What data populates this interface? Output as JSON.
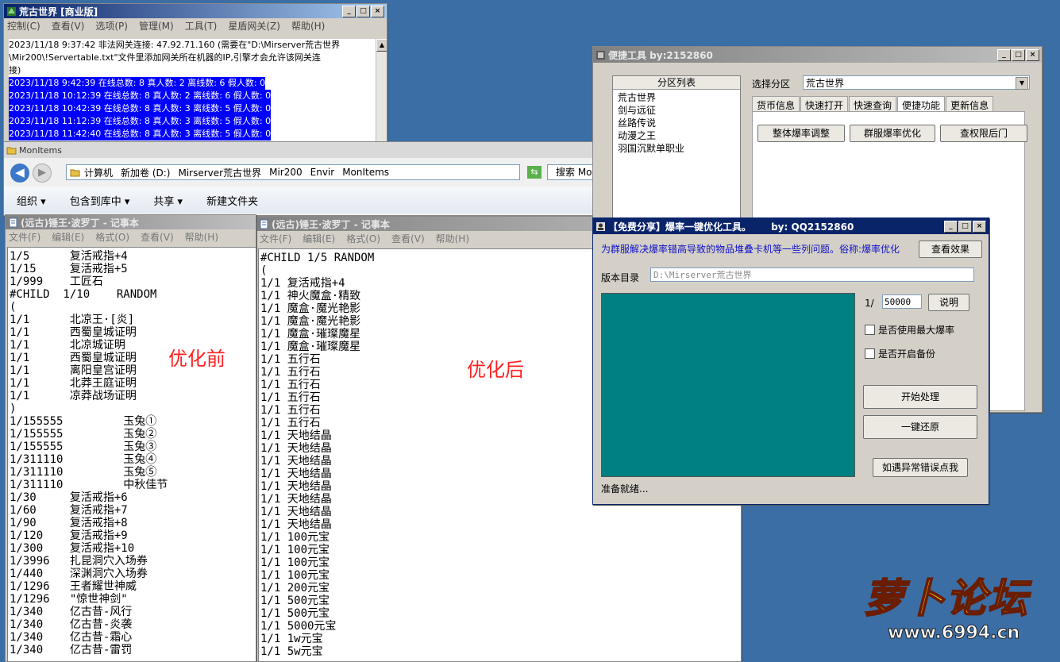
{
  "log_window": {
    "title": "荒古世界 [商业版]",
    "menu": [
      "控制(C)",
      "查看(V)",
      "选项(P)",
      "管理(M)",
      "工具(T)",
      "星盾网关(Z)",
      "帮助(H)"
    ],
    "lines": [
      "2023/11/18 9:37:42 非法网关连接: 47.92.71.160 (需要在\"D:\\Mirserver荒古世界",
      "\\Mir200\\!Servertable.txt\"文件里添加网关所在机器的IP,引擎才会允许该网关连",
      "接)"
    ],
    "highlighted": [
      "2023/11/18 9:42:39 在线总数: 8 真人数: 2 离线数: 6 假人数: 0",
      "2023/11/18 10:12:39 在线总数: 8 真人数: 2 离线数: 6 假人数: 0",
      "2023/11/18 10:42:39 在线总数: 8 真人数: 3 离线数: 5 假人数: 0",
      "2023/11/18 11:12:39 在线总数: 8 真人数: 3 离线数: 5 假人数: 0",
      "2023/11/18 11:42:40 在线总数: 8 真人数: 3 离线数: 5 假人数: 0"
    ]
  },
  "explorer": {
    "title": "MonItems",
    "path": [
      "计算机",
      "新加卷 (D:)",
      "Mirserver荒古世界",
      "Mir200",
      "Envir",
      "MonItems"
    ],
    "search": "搜索 Mon",
    "toolbar": [
      "组织",
      "包含到库中",
      "共享",
      "新建文件夹"
    ]
  },
  "notepad_left": {
    "title": "(远古)锤王·波罗丁 - 记事本",
    "menu": [
      "文件(F)",
      "编辑(E)",
      "格式(O)",
      "查看(V)",
      "帮助(H)"
    ],
    "content": "1/5      复活戒指+4\n1/15     复活戒指+5\n1/999    工匠石\n#CHILD  1/10    RANDOM\n(\n1/1      北凉王·[炎]\n1/1      西蜀皇城证明\n1/1      北凉城证明\n1/1      西蜀皇城证明\n1/1      离阳皇宫证明\n1/1      北莽王庭证明\n1/1      凉莽战场证明\n)\n1/155555         玉兔①\n1/155555         玉兔②\n1/155555         玉兔③\n1/311110         玉兔④\n1/311110         玉兔⑤\n1/311110         中秋佳节\n1/30     复活戒指+6\n1/60     复活戒指+7\n1/90     复活戒指+8\n1/120    复活戒指+9\n1/300    复活戒指+10\n1/3996   扎昆洞穴入场券\n1/440    深渊洞穴入场券\n1/1296   王者耀世神威\n1/1296   \"惊世神剑\"\n1/340    亿古昔-风行\n1/340    亿古昔-炎袭\n1/340    亿古昔-霜心\n1/340    亿古昔-雷罚"
  },
  "notepad_right": {
    "title": "(远古)锤王·波罗丁 - 记事本",
    "menu": [
      "文件(F)",
      "编辑(E)",
      "格式(O)",
      "查看(V)",
      "帮助(H)"
    ],
    "content": "#CHILD 1/5 RANDOM\n(\n1/1 复活戒指+4\n1/1 神火魔盒·精致\n1/1 魔盒·魔光艳影\n1/1 魔盒·魔光艳影\n1/1 魔盒·璀璨魔星\n1/1 魔盒·璀璨魔星\n1/1 五行石\n1/1 五行石\n1/1 五行石\n1/1 五行石\n1/1 五行石\n1/1 五行石\n1/1 天地结晶\n1/1 天地结晶\n1/1 天地结晶\n1/1 天地结晶\n1/1 天地结晶\n1/1 天地结晶\n1/1 天地结晶\n1/1 天地结晶\n1/1 100元宝\n1/1 100元宝\n1/1 100元宝\n1/1 100元宝\n1/1 200元宝\n1/1 500元宝\n1/1 500元宝\n1/1 5000元宝\n1/1 1w元宝\n1/1 5w元宝"
  },
  "annotations": {
    "before": "优化前",
    "after": "优化后"
  },
  "quick_tools": {
    "title": "便捷工具   by:2152860",
    "list_header": "分区列表",
    "partitions": [
      "荒古世界",
      "剑与远征",
      "丝路传说",
      "动漫之王",
      "羽国沉默单职业"
    ],
    "select_label": "选择分区",
    "selected_partition": "荒古世界",
    "tabs": [
      "货币信息",
      "快速打开",
      "快速查询",
      "便捷功能",
      "更新信息"
    ],
    "active_tab": "便捷功能",
    "buttons": [
      "整体爆率调整",
      "群服爆率优化",
      "查权限后门"
    ]
  },
  "optimizer": {
    "title": "【免费分享】爆率一键优化工具。      by: QQ2152860",
    "description": "为群服解决爆率错高导致的物品堆叠卡机等一些列问题。俗称:爆率优化",
    "view_effect": "查看效果",
    "dir_label": "版本目录",
    "dir_value": "D:\\Mirserver荒古世界",
    "ratio_prefix": "1/",
    "ratio_value": "50000",
    "explain": "说明",
    "opt_max_rate": "是否使用最大爆率",
    "opt_backup": "是否开启备份",
    "start": "开始处理",
    "restore": "一键还原",
    "report": "如遇异常错误点我",
    "status": "准备就绪...",
    "colors": {
      "panel": "#008080",
      "desc_text": "#1010c8"
    }
  },
  "watermark": {
    "brand": "萝卜论坛",
    "url": "www.6994.cn"
  }
}
